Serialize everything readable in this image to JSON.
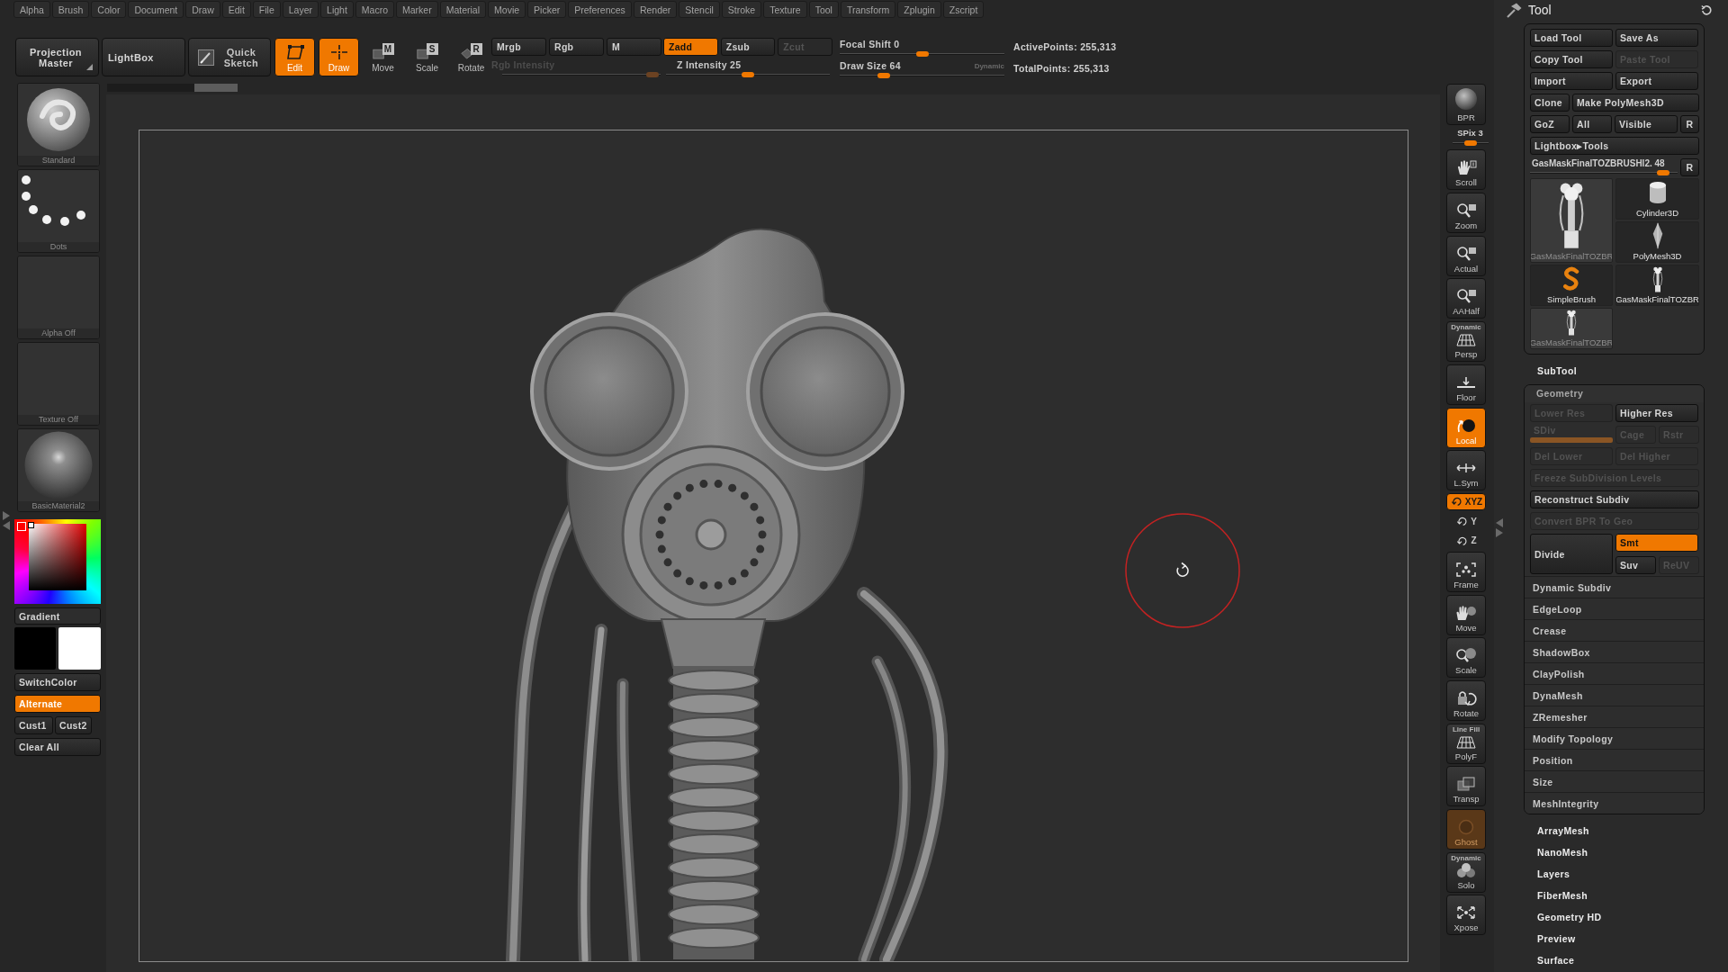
{
  "menu_bar": {
    "items": [
      "Alpha",
      "Brush",
      "Color",
      "Document",
      "Draw",
      "Edit",
      "File",
      "Layer",
      "Light",
      "Macro",
      "Marker",
      "Material",
      "Movie",
      "Picker",
      "Preferences",
      "Render",
      "Stencil",
      "Stroke",
      "Texture",
      "Tool",
      "Transform",
      "Zplugin",
      "Zscript"
    ]
  },
  "toolbar": {
    "projection_master": "Projection Master",
    "lightbox": "LightBox",
    "quick_sketch": "Quick Sketch",
    "modes": [
      {
        "kind": "edit",
        "label": "Edit",
        "selected": true
      },
      {
        "kind": "draw",
        "label": "Draw",
        "selected": true
      },
      {
        "kind": "move",
        "label": "Move",
        "hotkey": "M",
        "selected": false
      },
      {
        "kind": "scale",
        "label": "Scale",
        "hotkey": "S",
        "selected": false
      },
      {
        "kind": "rotate",
        "label": "Rotate",
        "hotkey": "R",
        "selected": false
      }
    ],
    "color_modes": [
      {
        "label": "Mrgb",
        "selected": false
      },
      {
        "label": "Rgb",
        "selected": false
      },
      {
        "label": "M",
        "selected": false
      }
    ],
    "rgb_intensity": {
      "label": "Rgb Intensity",
      "disabled": true,
      "level": 0.95
    },
    "sculpt_modes": [
      {
        "label": "Zadd",
        "selected": true,
        "disabled": false
      },
      {
        "label": "Zsub",
        "selected": false,
        "disabled": false
      },
      {
        "label": "Zcut",
        "selected": false,
        "disabled": true
      }
    ],
    "z_intensity": {
      "label": "Z Intensity",
      "value": "25",
      "level": 0.5
    },
    "focal_shift": {
      "label": "Focal Shift",
      "value": "0",
      "level": 0.5
    },
    "draw_size": {
      "label": "Draw Size",
      "value": "64",
      "level": 0.27,
      "option": "Dynamic"
    },
    "stats": [
      "ActivePoints: 255,313",
      "TotalPoints: 255,313"
    ]
  },
  "left_shelf": {
    "tiles": [
      {
        "kind": "brush",
        "label": "Standard"
      },
      {
        "kind": "stroke",
        "label": "Dots"
      },
      {
        "kind": "alpha",
        "label": "Alpha Off"
      },
      {
        "kind": "texture",
        "label": "Texture Off"
      },
      {
        "kind": "material",
        "label": "BasicMaterial2"
      }
    ],
    "gradient": "Gradient",
    "swatches": [
      {
        "color": "#000000"
      },
      {
        "color": "#ffffff"
      }
    ],
    "switch_color": "SwitchColor",
    "alternate": {
      "label": "Alternate",
      "on": true
    },
    "custom": [
      "Cust1",
      "Cust2"
    ],
    "clear_all": "Clear All"
  },
  "view_shelf": {
    "bpr": {
      "label": "BPR"
    },
    "spix": {
      "label": "SPix",
      "value": "3",
      "level": 0.5
    },
    "buttons": [
      {
        "kind": "scroll",
        "label": "Scroll",
        "on": false,
        "disabled": false
      },
      {
        "kind": "zoom",
        "label": "Zoom",
        "on": false,
        "disabled": false
      },
      {
        "kind": "actual",
        "label": "Actual",
        "on": false,
        "disabled": false
      },
      {
        "kind": "aahalf",
        "label": "AAHalf",
        "on": false,
        "disabled": false
      },
      {
        "kind": "persp",
        "label": "Persp",
        "caption": "Dynamic",
        "on": false,
        "disabled": false
      },
      {
        "kind": "floor",
        "label": "Floor",
        "on": false,
        "disabled": false
      },
      {
        "kind": "local",
        "label": "Local",
        "on": true,
        "disabled": false
      },
      {
        "kind": "lsym",
        "label": "L.Sym",
        "on": false,
        "disabled": false
      },
      {
        "kind": "xyz",
        "label": "XYZ",
        "on": true,
        "disabled": false
      },
      {
        "kind": "axis",
        "label": "Y",
        "on": false,
        "disabled": false
      },
      {
        "kind": "axis",
        "label": "Z",
        "on": false,
        "disabled": false
      },
      {
        "kind": "frame",
        "label": "Frame",
        "on": false,
        "disabled": false
      },
      {
        "kind": "move",
        "label": "Move",
        "on": false,
        "disabled": false
      },
      {
        "kind": "scale",
        "label": "Scale",
        "on": false,
        "disabled": false
      },
      {
        "kind": "rotate",
        "label": "Rotate",
        "on": false,
        "disabled": false
      },
      {
        "kind": "polyf",
        "label": "PolyF",
        "caption": "Line Fill",
        "on": false,
        "disabled": false
      },
      {
        "kind": "transp",
        "label": "Transp",
        "on": false,
        "disabled": false
      },
      {
        "kind": "ghost",
        "label": "Ghost",
        "on": true,
        "disabled": true
      },
      {
        "kind": "solo",
        "label": "Solo",
        "caption": "Dynamic",
        "on": false,
        "disabled": false
      },
      {
        "kind": "xpose",
        "label": "Xpose",
        "on": false,
        "disabled": false
      }
    ]
  },
  "tool_palette": {
    "title": "Tool",
    "button_rows": [
      [
        {
          "label": "Load Tool",
          "kind": "half",
          "disabled": false
        },
        {
          "label": "Save As",
          "kind": "half",
          "disabled": false
        }
      ],
      [
        {
          "label": "Copy Tool",
          "kind": "half",
          "disabled": false
        },
        {
          "label": "Paste Tool",
          "kind": "half",
          "disabled": true
        }
      ],
      [
        {
          "label": "Import",
          "kind": "half",
          "disabled": false
        },
        {
          "label": "Export",
          "kind": "half",
          "disabled": false
        }
      ],
      [
        {
          "label": "Clone",
          "kind": "narrow",
          "disabled": false
        },
        {
          "label": "Make PolyMesh3D",
          "kind": "wide",
          "disabled": false
        }
      ],
      [
        {
          "label": "GoZ",
          "kind": "narrow",
          "disabled": false
        },
        {
          "label": "All",
          "kind": "narrow",
          "disabled": false
        },
        {
          "label": "Visible",
          "kind": "medium",
          "disabled": false
        },
        {
          "label": "R",
          "kind": "tiny",
          "disabled": false
        }
      ],
      [
        {
          "label": "Lightbox▸Tools",
          "kind": "full",
          "disabled": false
        }
      ]
    ],
    "tool_slider": {
      "label": "GasMaskFinalTOZBRUSHl2.",
      "value": "48",
      "level": 0.9,
      "reset": "R"
    },
    "tools": [
      {
        "label": "GasMaskFinalTOZBR",
        "kind": "mask",
        "selected": true
      },
      {
        "label": "SimpleBrush",
        "kind": "brush",
        "selected": false
      },
      {
        "label": "GasMaskFinalTOZBR",
        "kind": "mask",
        "selected": true
      },
      {
        "label": "Cylinder3D",
        "kind": "cylinder",
        "selected": false
      },
      {
        "label": "PolyMesh3D",
        "kind": "polymesh",
        "selected": false
      },
      {
        "label": "GasMaskFinalTOZBR",
        "kind": "mask",
        "selected": false
      }
    ],
    "subtool": "SubTool",
    "geometry": {
      "title": "Geometry",
      "rows": [
        [
          {
            "label": "Lower Res",
            "kind": "half",
            "disabled": true
          },
          {
            "label": "Higher Res",
            "kind": "half",
            "disabled": false
          }
        ],
        [
          {
            "label": "SDiv",
            "kind": "slider",
            "disabled": true,
            "level": 1
          },
          {
            "label": "Cage",
            "kind": "quarter",
            "disabled": true
          },
          {
            "label": "Rstr",
            "kind": "quarter",
            "disabled": true
          }
        ],
        [
          {
            "label": "Del Lower",
            "kind": "half",
            "disabled": true
          },
          {
            "label": "Del Higher",
            "kind": "half",
            "disabled": true
          }
        ],
        [
          {
            "label": "Freeze SubDivision Levels",
            "kind": "full",
            "disabled": true
          }
        ],
        [
          {
            "label": "Reconstruct Subdiv",
            "kind": "full",
            "disabled": false
          }
        ],
        [
          {
            "label": "Convert BPR To Geo",
            "kind": "full",
            "disabled": true
          }
        ]
      ],
      "divide": "Divide",
      "divide_options": [
        {
          "label": "Smt",
          "kind": "half",
          "on": true,
          "disabled": false
        },
        {
          "label": "Suv",
          "kind": "quarter",
          "on": false,
          "disabled": false
        },
        {
          "label": "ReUV",
          "kind": "quarter",
          "on": false,
          "disabled": true
        }
      ],
      "subpalettes": [
        "Dynamic Subdiv",
        "EdgeLoop",
        "Crease",
        "ShadowBox",
        "ClayPolish",
        "DynaMesh",
        "ZRemesher",
        "Modify Topology",
        "Position",
        "Size",
        "MeshIntegrity"
      ]
    },
    "palettes": [
      "ArrayMesh",
      "NanoMesh",
      "Layers",
      "FiberMesh",
      "Geometry HD",
      "Preview",
      "Surface"
    ]
  }
}
